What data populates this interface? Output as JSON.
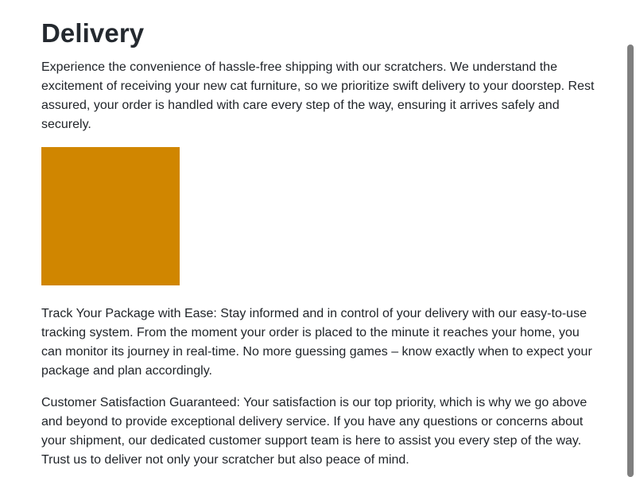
{
  "page": {
    "title": "Delivery",
    "intro": "Experience the convenience of hassle-free shipping with our scratchers. We understand the excitement of receiving your new cat furniture, so we prioritize swift delivery to your doorstep. Rest assured, your order is handled with care every step of the way, ensuring it arrives safely and securely.",
    "image_color": "#d08600",
    "tracking": "Track Your Package with Ease: Stay informed and in control of your delivery with our easy-to-use tracking system. From the moment your order is placed to the minute it reaches your home, you can monitor its journey in real-time. No more guessing games – know exactly when to expect your package and plan accordingly.",
    "satisfaction": "Customer Satisfaction Guaranteed: Your satisfaction is our top priority, which is why we go above and beyond to provide exceptional delivery service. If you have any questions or concerns about your shipment, our dedicated customer support team is here to assist you every step of the way. Trust us to deliver not only your scratcher but also peace of mind."
  }
}
